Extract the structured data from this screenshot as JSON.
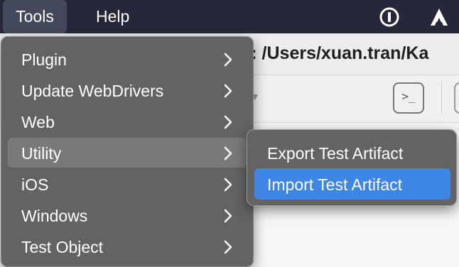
{
  "menubar": {
    "items": [
      {
        "label": "Tools"
      },
      {
        "label": "Help"
      }
    ],
    "status_icons": [
      "onepassword-icon",
      "arrow-a-icon"
    ]
  },
  "window": {
    "path_text": "n: /Users/xuan.tran/Ka",
    "terminal_button_label": ">_"
  },
  "tools_menu": {
    "items": [
      {
        "label": "Plugin",
        "has_submenu": true
      },
      {
        "label": "Update WebDrivers",
        "has_submenu": true
      },
      {
        "label": "Web",
        "has_submenu": true
      },
      {
        "label": "Utility",
        "has_submenu": true,
        "active": true
      },
      {
        "label": "iOS",
        "has_submenu": true
      },
      {
        "label": "Windows",
        "has_submenu": true
      },
      {
        "label": "Test Object",
        "has_submenu": true
      }
    ]
  },
  "utility_submenu": {
    "items": [
      {
        "label": "Export Test Artifact"
      },
      {
        "label": "Import Test Artifact",
        "highlighted": true
      }
    ]
  },
  "colors": {
    "menubar_bg": "#26283a",
    "menu_bg": "#646262",
    "highlight": "#3d86e6"
  }
}
